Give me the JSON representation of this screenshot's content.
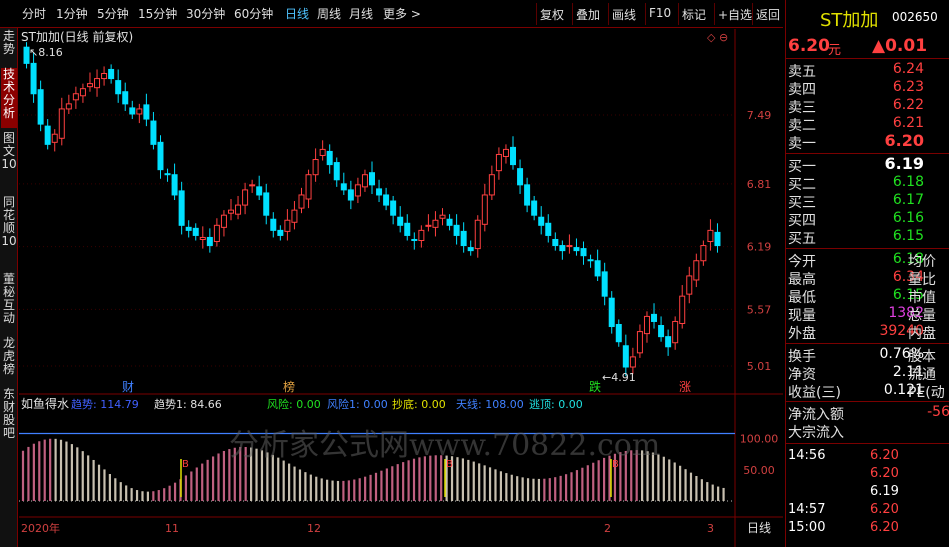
{
  "toolbar": {
    "periods": [
      "分时",
      "1分钟",
      "5分钟",
      "15分钟",
      "30分钟",
      "60分钟",
      "日线",
      "周线",
      "月线",
      "更多 >"
    ],
    "active_period": "日线",
    "buttons": [
      "复权",
      "叠加",
      "画线",
      "F10",
      "标记",
      "+自选",
      "返回"
    ]
  },
  "left_tabs": [
    {
      "label": "分时走势",
      "active": false
    },
    {
      "label": "技术分析",
      "active": true
    },
    {
      "label": "图文10",
      "active": false
    },
    {
      "label": "同花顺10",
      "active": false
    },
    {
      "label": "董秘互动",
      "active": false
    },
    {
      "label": "龙虎榜",
      "active": false
    },
    {
      "label": "东财股吧",
      "active": false
    }
  ],
  "chart": {
    "title": "ST加加(日线 前复权)",
    "high_marker": "8.16",
    "low_marker": "4.91",
    "y_ticks": [
      "7.49",
      "6.81",
      "6.19",
      "5.57",
      "5.01"
    ],
    "y_ticks_values": [
      7.49,
      6.81,
      6.19,
      5.57,
      5.01
    ],
    "event_tags": [
      {
        "text": "财",
        "color": "#4080ff"
      },
      {
        "text": "榜",
        "color": "#e0a040"
      },
      {
        "text": "跌",
        "color": "#20e020"
      },
      {
        "text": "涨",
        "color": "#ff4040"
      }
    ],
    "x_labels": [
      "2020年",
      "11",
      "12",
      "2",
      "3"
    ],
    "period_label": "日线"
  },
  "indicator": {
    "name": "如鱼得水",
    "items": [
      {
        "text": "趋势: 114.79",
        "color": "#4060ff"
      },
      {
        "text": "趋势1: 84.66",
        "color": "#e0e0e0"
      },
      {
        "text": "风险: 0.00",
        "color": "#20e020"
      },
      {
        "text": "风险1: 0.00",
        "color": "#4080ff"
      },
      {
        "text": "抄底: 0.00",
        "color": "#e0e000"
      },
      {
        "text": "天线: 108.00",
        "color": "#4080ff"
      },
      {
        "text": "逃顶: 0.00",
        "color": "#20e0e0"
      }
    ],
    "y_ticks": [
      "100.00",
      "50.00"
    ],
    "markers": [
      "B",
      "B",
      "B"
    ]
  },
  "watermark": "分析家公式网www.70822.com",
  "quote": {
    "name": "ST加加",
    "code": "002650",
    "price": "6.20",
    "price_unit": "元",
    "change": "▲0.01",
    "asks": [
      {
        "label": "卖五",
        "price": "6.24"
      },
      {
        "label": "卖四",
        "price": "6.23"
      },
      {
        "label": "卖三",
        "price": "6.22"
      },
      {
        "label": "卖二",
        "price": "6.21"
      },
      {
        "label": "卖一",
        "price": "6.20"
      }
    ],
    "bids": [
      {
        "label": "买一",
        "price": "6.19"
      },
      {
        "label": "买二",
        "price": "6.18"
      },
      {
        "label": "买三",
        "price": "6.17"
      },
      {
        "label": "买四",
        "price": "6.16"
      },
      {
        "label": "买五",
        "price": "6.15"
      }
    ],
    "stats": [
      {
        "label": "今开",
        "value": "6.18",
        "color": "green",
        "label2": "均价"
      },
      {
        "label": "最高",
        "value": "6.34",
        "color": "red",
        "label2": "量比"
      },
      {
        "label": "最低",
        "value": "6.15",
        "color": "green",
        "label2": "市值"
      },
      {
        "label": "现量",
        "value": "1382",
        "color": "magenta",
        "label2": "总量"
      },
      {
        "label": "外盘",
        "value": "39240",
        "color": "red",
        "label2": "内盘"
      }
    ],
    "stats2": [
      {
        "label": "换手",
        "value": "0.76%",
        "label2": "股本"
      },
      {
        "label": "净资",
        "value": "2.11",
        "label2": "流通"
      },
      {
        "label": "收益(三)",
        "value": "0.121",
        "label2": "PE(动"
      }
    ],
    "flows": [
      {
        "label": "净流入额",
        "value": "-56"
      },
      {
        "label": "大宗流入",
        "value": ""
      }
    ],
    "ticks": [
      {
        "time": "14:56",
        "price": "6.20"
      },
      {
        "time": "",
        "price": "6.20"
      },
      {
        "time": "",
        "price": "6.19"
      },
      {
        "time": "14:57",
        "price": "6.20"
      },
      {
        "time": "15:00",
        "price": "6.20"
      }
    ]
  }
}
